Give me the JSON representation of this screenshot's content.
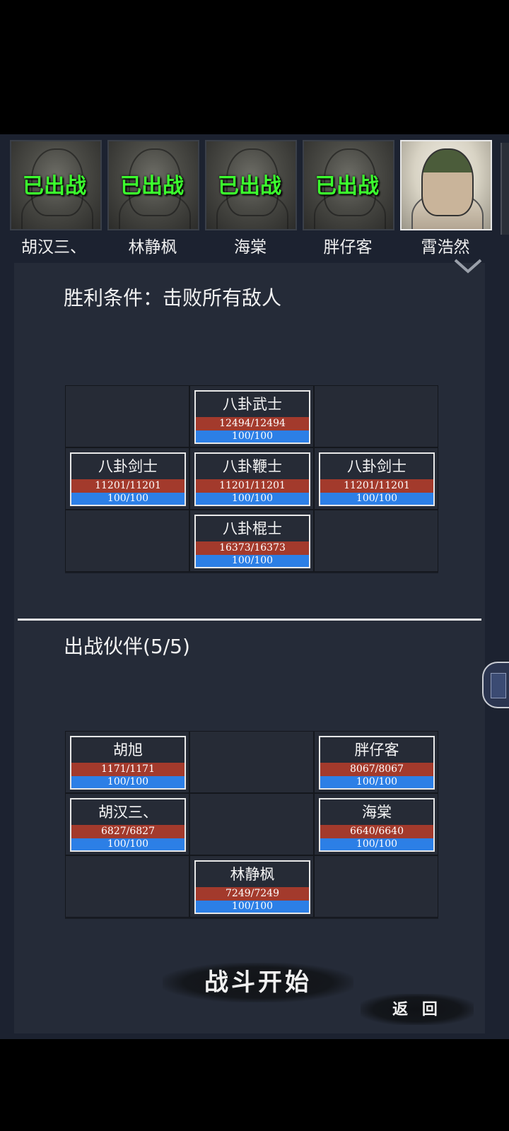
{
  "roster": [
    {
      "name": "胡汉三、",
      "status": "已出战",
      "deployed": true
    },
    {
      "name": "林静枫",
      "status": "已出战",
      "deployed": true
    },
    {
      "name": "海棠",
      "status": "已出战",
      "deployed": true
    },
    {
      "name": "胖仔客",
      "status": "已出战",
      "deployed": true
    },
    {
      "name": "霄浩然",
      "status": "",
      "deployed": false
    }
  ],
  "victory": {
    "label": "胜利条件：击败所有敌人"
  },
  "enemies": {
    "grid": [
      [
        null,
        {
          "name": "八卦武士",
          "hp": "12494/12494",
          "mp": "100/100"
        },
        null
      ],
      [
        {
          "name": "八卦剑士",
          "hp": "11201/11201",
          "mp": "100/100"
        },
        {
          "name": "八卦鞭士",
          "hp": "11201/11201",
          "mp": "100/100"
        },
        {
          "name": "八卦剑士",
          "hp": "11201/11201",
          "mp": "100/100"
        }
      ],
      [
        null,
        {
          "name": "八卦棍士",
          "hp": "16373/16373",
          "mp": "100/100"
        },
        null
      ]
    ]
  },
  "party": {
    "label": "出战伙伴(5/5)",
    "grid": [
      [
        {
          "name": "胡旭",
          "hp": "1171/1171",
          "mp": "100/100"
        },
        null,
        {
          "name": "胖仔客",
          "hp": "8067/8067",
          "mp": "100/100"
        }
      ],
      [
        {
          "name": "胡汉三、",
          "hp": "6827/6827",
          "mp": "100/100"
        },
        null,
        {
          "name": "海棠",
          "hp": "6640/6640",
          "mp": "100/100"
        }
      ],
      [
        null,
        {
          "name": "林静枫",
          "hp": "7249/7249",
          "mp": "100/100"
        },
        null
      ]
    ]
  },
  "buttons": {
    "start": "战斗开始",
    "back": "返 回"
  },
  "colors": {
    "hp_bar": "#a33a2c",
    "mp_bar": "#2c7fe6",
    "deployed_text": "#3cff2e",
    "panel": "#252b38"
  }
}
